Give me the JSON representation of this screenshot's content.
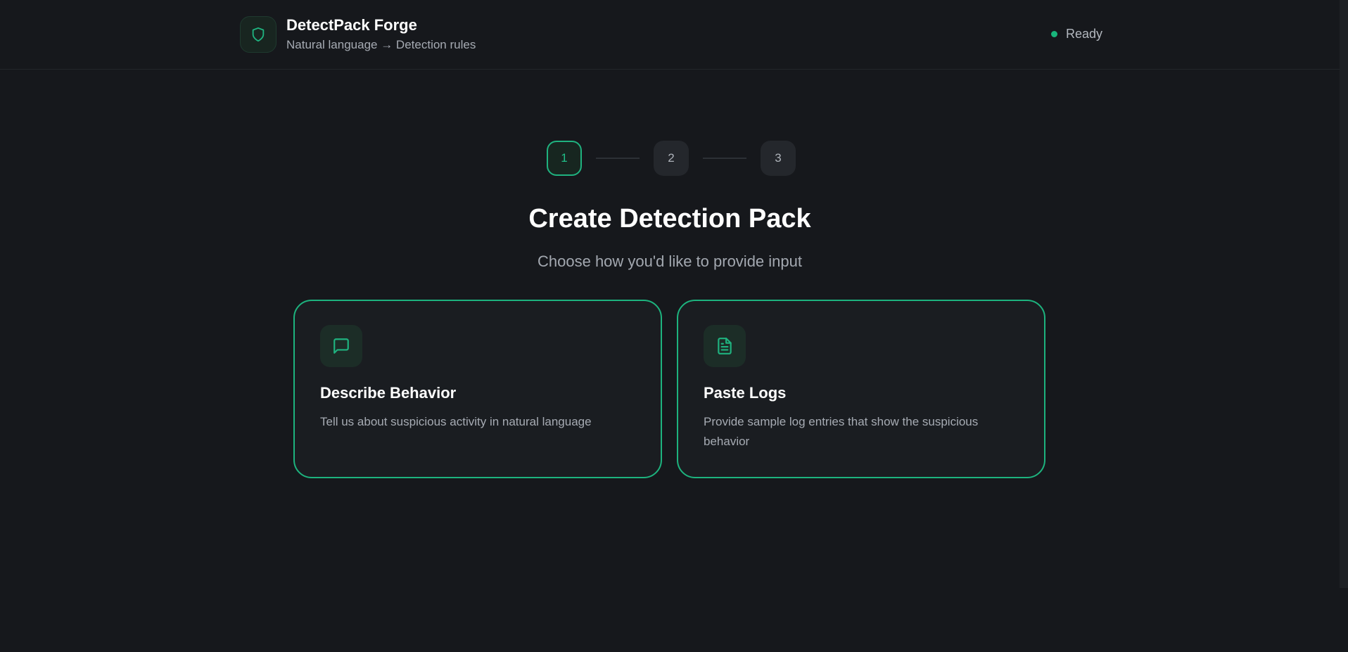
{
  "header": {
    "title": "DetectPack Forge",
    "subtitle": "Natural language → Detection rules",
    "status": "Ready",
    "logo_icon": "shield-icon"
  },
  "steps": [
    {
      "label": "1",
      "active": true
    },
    {
      "label": "2",
      "active": false
    },
    {
      "label": "3",
      "active": false
    }
  ],
  "main": {
    "title": "Create Detection Pack",
    "subtitle": "Choose how you'd like to provide input"
  },
  "options": [
    {
      "icon": "message-square-icon",
      "title": "Describe Behavior",
      "description": "Tell us about suspicious activity in natural language"
    },
    {
      "icon": "file-text-icon",
      "title": "Paste Logs",
      "description": "Provide sample log entries that show the suspicious behavior"
    }
  ],
  "colors": {
    "background": "#16181c",
    "accent": "#1db37e",
    "card": "#1a1d21"
  }
}
